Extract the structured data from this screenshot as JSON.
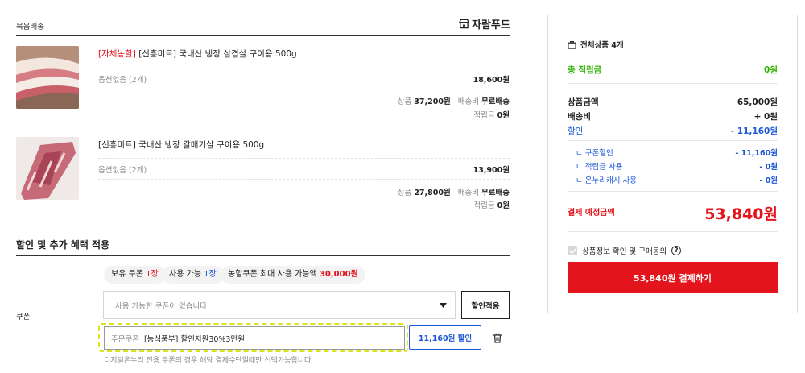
{
  "left": {
    "bundle_label": "묶음배송",
    "brand_name": "자람푸드",
    "products": [
      {
        "tag": "[자체농할]",
        "title": "[신흥미트] 국내산 냉장 삼겹살 구이용 500g",
        "option": "옵션없음 (2개)",
        "option_price": "18,600원",
        "goods_label": "상품",
        "goods_price": "37,200원",
        "ship_label": "배송비",
        "ship_value": "무료배송",
        "point_label": "적립금",
        "point_value": "0원"
      },
      {
        "tag": "",
        "title": "[신흥미트] 국내산 냉장 갈매기살 구이용 500g",
        "option": "옵션없음 (2개)",
        "option_price": "13,900원",
        "goods_label": "상품",
        "goods_price": "27,800원",
        "ship_label": "배송비",
        "ship_value": "무료배송",
        "point_label": "적립금",
        "point_value": "0원"
      }
    ],
    "discount_section_title": "할인 및 추가 혜택 적용",
    "coupon_label": "쿠폰",
    "chips": {
      "owned_label": "보유 쿠폰",
      "owned_value": "1장",
      "usable_label": "사용 가능",
      "usable_value": "1장",
      "max_label": "농할쿠폰 최대 사용 가능액",
      "max_value": "30,000원"
    },
    "coupon_select_placeholder": "사용 가능한 쿠폰이 없습니다.",
    "apply_button": "할인적용",
    "order_coupon_prefix": "주문쿠폰",
    "order_coupon_name": "[농식품부] 할인지원30%3만원",
    "order_coupon_discount": "11,160원 할인",
    "footnote": "디지털온누리 전용 쿠폰의 경우 해당 결제수단일때만 선택가능합니다."
  },
  "summary": {
    "header": "전체상품 4개",
    "total_points_label": "총 적립금",
    "total_points_value": "0원",
    "goods_amount_label": "상품금액",
    "goods_amount_value": "65,000원",
    "shipping_label": "배송비",
    "shipping_value": "+ 0원",
    "discount_label": "할인",
    "discount_value": "- 11,160원",
    "sub_items": [
      {
        "label": "ㄴ 쿠폰할인",
        "value": "- 11,160원"
      },
      {
        "label": "ㄴ 적립금 사용",
        "value": "- 0원"
      },
      {
        "label": "ㄴ 온누리캐시 사용",
        "value": "- 0원"
      }
    ],
    "pay_total_label": "결제 예정금액",
    "pay_total_value": "53,840원",
    "agree_label": "상품정보 확인 및 구매동의",
    "pay_button": "53,840원 결제하기"
  },
  "colors": {
    "accent_red": "#e4141c",
    "green": "#2db400",
    "blue": "#1a56d6"
  }
}
